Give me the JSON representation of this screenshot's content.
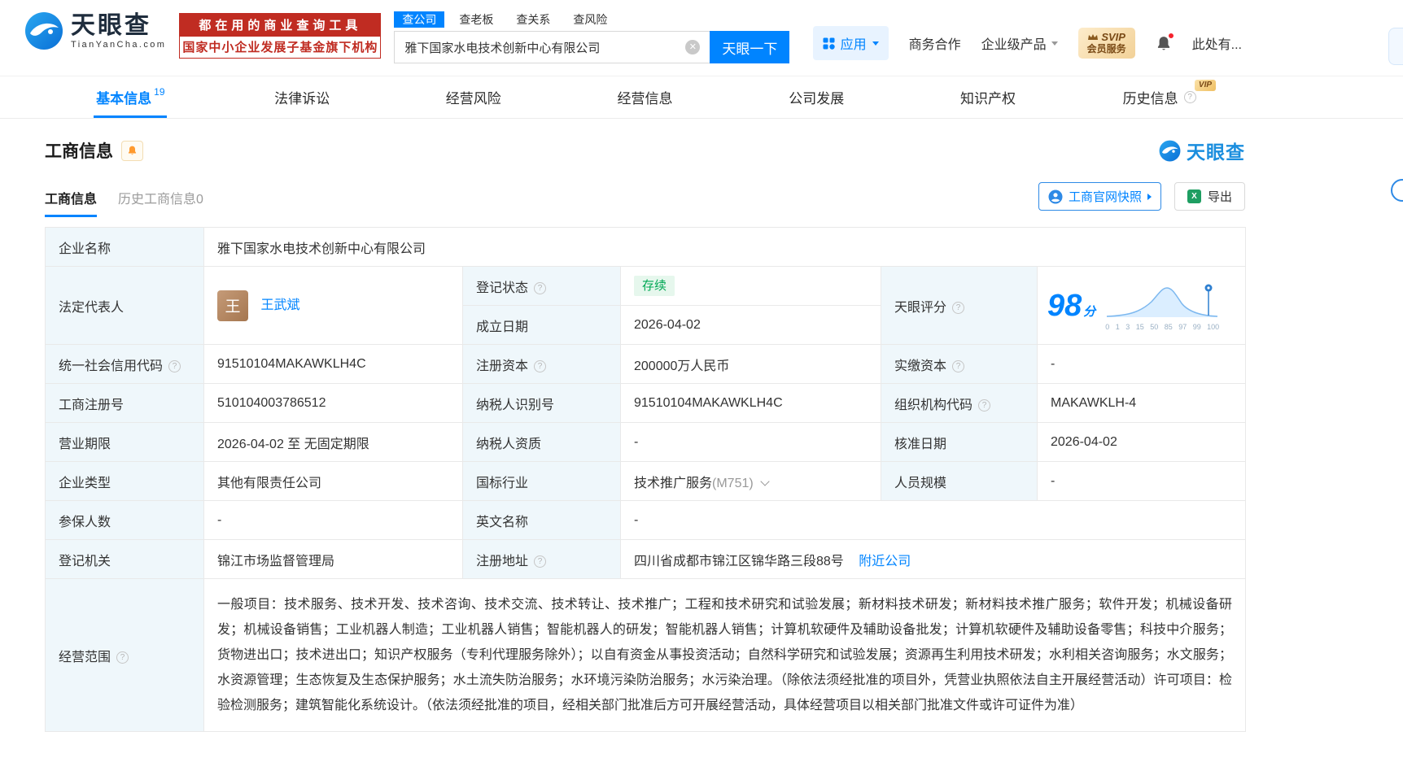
{
  "colors": {
    "primary_blue": "#0084ff",
    "promo_red": "#c02c22",
    "status_green": "#00a854",
    "svip_gold": "#f2d197",
    "label_bg": "#eff7fb"
  },
  "header": {
    "logo": {
      "brand": "天眼查",
      "domain": "TianYanCha.com"
    },
    "promo": {
      "line1": "都在用的商业查询工具",
      "line2": "国家中小企业发展子基金旗下机构"
    },
    "search": {
      "tabs": [
        {
          "label": "查公司"
        },
        {
          "label": "查老板"
        },
        {
          "label": "查关系"
        },
        {
          "label": "查风险"
        }
      ],
      "value": "雅下国家水电技术创新中心有限公司",
      "button_label": "天眼一下"
    },
    "menu": {
      "apps": "应用",
      "cooperation": "商务合作",
      "enterprise": "企业级产品",
      "svip_top": "SVIP",
      "svip_bottom": "会员服务",
      "more": "此处有..."
    }
  },
  "nav": {
    "tabs": [
      {
        "label": "基本信息",
        "count": "19"
      },
      {
        "label": "法律诉讼"
      },
      {
        "label": "经营风险"
      },
      {
        "label": "经营信息"
      },
      {
        "label": "公司发展"
      },
      {
        "label": "知识产权"
      },
      {
        "label": "历史信息",
        "badge": "VIP"
      }
    ]
  },
  "section": {
    "title": "工商信息",
    "brand": "天眼查",
    "subtabs": [
      {
        "label": "工商信息"
      },
      {
        "label": "历史工商信息0"
      }
    ],
    "snapshot_label": "工商官网快照",
    "export_label": "导出"
  },
  "table": {
    "company_name": {
      "label": "企业名称",
      "value": "雅下国家水电技术创新中心有限公司"
    },
    "legal_rep": {
      "label": "法定代表人",
      "avatar": "王",
      "value": "王武斌"
    },
    "reg_status": {
      "label": "登记状态",
      "value": "存续"
    },
    "establish_date": {
      "label": "成立日期",
      "value": "2026-04-02"
    },
    "score": {
      "label": "天眼评分",
      "value": "98",
      "unit": "分"
    },
    "credit_code": {
      "label": "统一社会信用代码",
      "value": "91510104MAKAWKLH4C"
    },
    "reg_capital": {
      "label": "注册资本",
      "value": "200000万人民币"
    },
    "paid_capital": {
      "label": "实缴资本",
      "value": "-"
    },
    "reg_number": {
      "label": "工商注册号",
      "value": "510104003786512"
    },
    "taxpayer_id": {
      "label": "纳税人识别号",
      "value": "91510104MAKAWKLH4C"
    },
    "org_code": {
      "label": "组织机构代码",
      "value": "MAKAWKLH-4"
    },
    "business_term": {
      "label": "营业期限",
      "value": "2026-04-02 至 无固定期限"
    },
    "taxpayer_quality": {
      "label": "纳税人资质",
      "value": "-"
    },
    "approval_date": {
      "label": "核准日期",
      "value": "2026-04-02"
    },
    "company_type": {
      "label": "企业类型",
      "value": "其他有限责任公司"
    },
    "industry": {
      "label": "国标行业",
      "value": "技术推广服务",
      "code": "(M751)"
    },
    "staff_size": {
      "label": "人员规模",
      "value": "-"
    },
    "insured_count": {
      "label": "参保人数",
      "value": "-"
    },
    "english_name": {
      "label": "英文名称",
      "value": "-"
    },
    "reg_authority": {
      "label": "登记机关",
      "value": "锦江市场监督管理局"
    },
    "reg_address": {
      "label": "注册地址",
      "value": "四川省成都市锦江区锦华路三段88号",
      "link": "附近公司"
    },
    "business_scope": {
      "label": "经营范围",
      "value": "一般项目：技术服务、技术开发、技术咨询、技术交流、技术转让、技术推广；工程和技术研究和试验发展；新材料技术研发；新材料技术推广服务；软件开发；机械设备研发；机械设备销售；工业机器人制造；工业机器人销售；智能机器人的研发；智能机器人销售；计算机软硬件及辅助设备批发；计算机软硬件及辅助设备零售；科技中介服务；货物进出口；技术进出口；知识产权服务（专利代理服务除外）；以自有资金从事投资活动；自然科学研究和试验发展；资源再生利用技术研发；水利相关咨询服务；水文服务；水资源管理；生态恢复及生态保护服务；水土流失防治服务；水环境污染防治服务；水污染治理。（除依法须经批准的项目外，凭营业执照依法自主开展经营活动）许可项目：检验检测服务；建筑智能化系统设计。（依法须经批准的项目，经相关部门批准后方可开展经营活动，具体经营项目以相关部门批准文件或许可证件为准）"
    }
  },
  "chart_data": {
    "type": "line",
    "title": "天眼评分分布曲线",
    "score": 98,
    "x_ticks": [
      "0",
      "1",
      "3",
      "15",
      "50",
      "85",
      "97",
      "99",
      "100"
    ],
    "marker_at": 98
  }
}
